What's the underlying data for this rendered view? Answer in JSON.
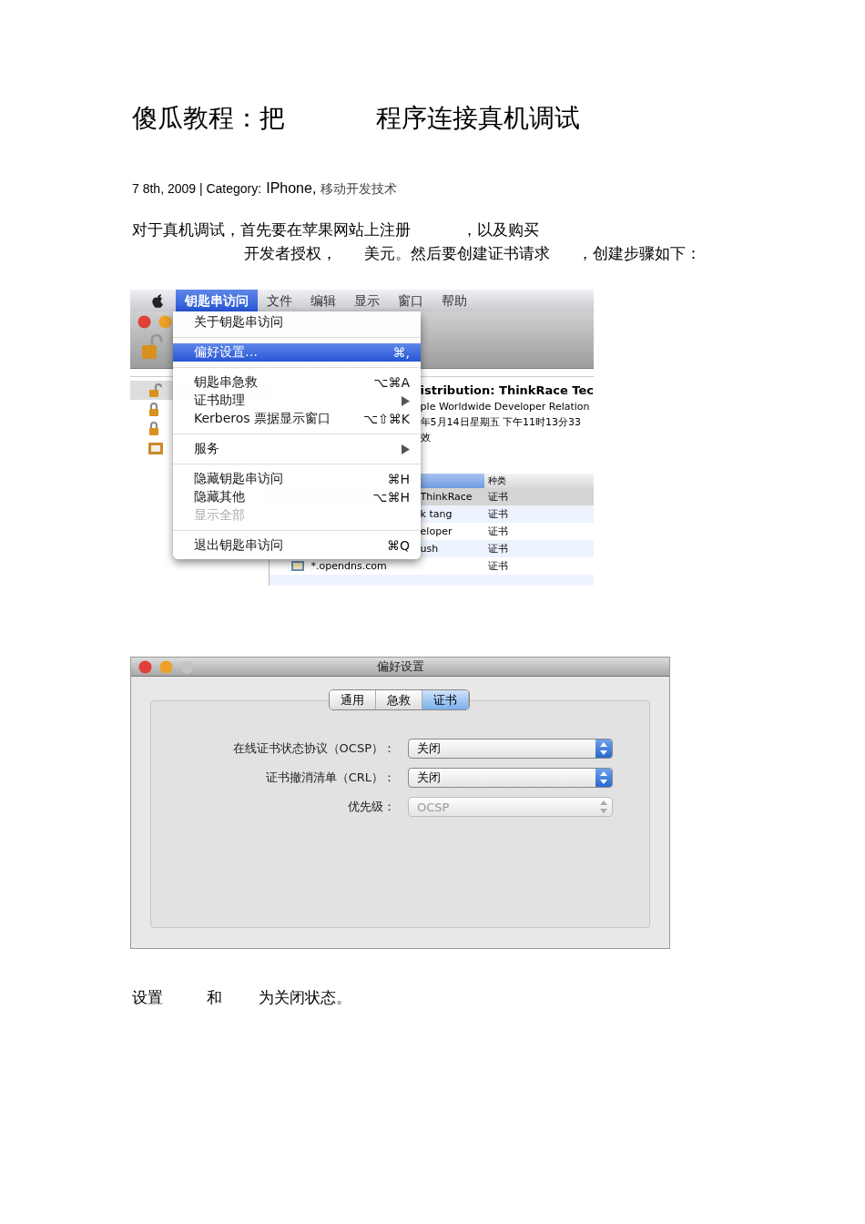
{
  "title": [
    "傻瓜教程：把",
    "程序连接真机调试"
  ],
  "meta": {
    "text": "7 8th, 2009 | Category:",
    "categories": [
      "IPhone,",
      "移动开发技术"
    ]
  },
  "intro": [
    [
      "对于真机调试，首先要在苹果网站上注册",
      "，以及购买"
    ],
    [
      "开发者授权，",
      "美元。然后要创建证书请求",
      "，创建步骤如下："
    ]
  ],
  "keychain_screenshot": {
    "menu_bar": [
      {
        "label": "钥匙串访问",
        "selected": true
      },
      {
        "label": "文件",
        "selected": false
      },
      {
        "label": "编辑",
        "selected": false
      },
      {
        "label": "显示",
        "selected": false
      },
      {
        "label": "窗口",
        "selected": false
      },
      {
        "label": "帮助",
        "selected": false
      }
    ],
    "menu": [
      {
        "kind": "item",
        "label": "关于钥匙串访问",
        "selected": false,
        "disabled": false
      },
      {
        "kind": "separator"
      },
      {
        "kind": "item",
        "label": "偏好设置…",
        "shortcut": "⌘,",
        "selected": true,
        "disabled": false
      },
      {
        "kind": "separator"
      },
      {
        "kind": "item",
        "label": "钥匙串急救",
        "shortcut": "⌥⌘A",
        "selected": false,
        "disabled": false
      },
      {
        "kind": "submenu",
        "label": "证书助理",
        "selected": false,
        "disabled": false
      },
      {
        "kind": "item",
        "label": "Kerberos 票据显示窗口",
        "shortcut": "⌥⇧⌘K",
        "selected": false,
        "disabled": false
      },
      {
        "kind": "separator"
      },
      {
        "kind": "submenu",
        "label": "服务",
        "selected": false,
        "disabled": false
      },
      {
        "kind": "separator"
      },
      {
        "kind": "item",
        "label": "隐藏钥匙串访问",
        "shortcut": "⌘H",
        "selected": false,
        "disabled": false
      },
      {
        "kind": "item",
        "label": "隐藏其他",
        "shortcut": "⌥⌘H",
        "selected": false,
        "disabled": false
      },
      {
        "kind": "item",
        "label": "显示全部",
        "selected": false,
        "disabled": true
      },
      {
        "kind": "separator"
      },
      {
        "kind": "item",
        "label": "退出钥匙串访问",
        "shortcut": "⌘Q",
        "selected": false,
        "disabled": false
      }
    ],
    "sidebar": [
      {
        "kind": "unlocked",
        "selected": true
      },
      {
        "kind": "locked",
        "selected": false
      },
      {
        "kind": "locked",
        "selected": false
      },
      {
        "kind": "certificates",
        "selected": false
      }
    ],
    "detail": {
      "title": "istribution: ThinkRace Tec",
      "issuer": "ple Worldwide Developer Relation",
      "expires": "年5月14日星期五 下午11时13分33",
      "status": "效"
    },
    "table": {
      "columns": [
        "种类"
      ],
      "rows": [
        {
          "kind": "plain",
          "name": "ThinkRace",
          "type": "证书",
          "selected": true
        },
        {
          "kind": "plain",
          "name": "k tang",
          "type": "证书",
          "selected": false
        },
        {
          "kind": "plain",
          "name": "eloper",
          "type": "证书",
          "selected": false
        },
        {
          "kind": "plain",
          "name": "ush",
          "type": "证书",
          "selected": false
        },
        {
          "kind": "certificate",
          "name": "*.opendns.com",
          "type": "证书",
          "selected": false
        }
      ]
    }
  },
  "preferences_screenshot": {
    "window": {
      "title": "偏好设置"
    },
    "tabs": [
      {
        "label": "通用",
        "selected": false
      },
      {
        "label": "急救",
        "selected": false
      },
      {
        "label": "证书",
        "selected": true
      }
    ],
    "fields": [
      {
        "label": "在线证书状态协议（OCSP）：",
        "value": "关闭",
        "disabled": false
      },
      {
        "label": "证书撤消清单（CRL）：",
        "value": "关闭",
        "disabled": false
      },
      {
        "label": "优先级：",
        "value": "OCSP",
        "disabled": true
      }
    ]
  },
  "outro": [
    "设置",
    "和",
    "为关闭状态。"
  ]
}
